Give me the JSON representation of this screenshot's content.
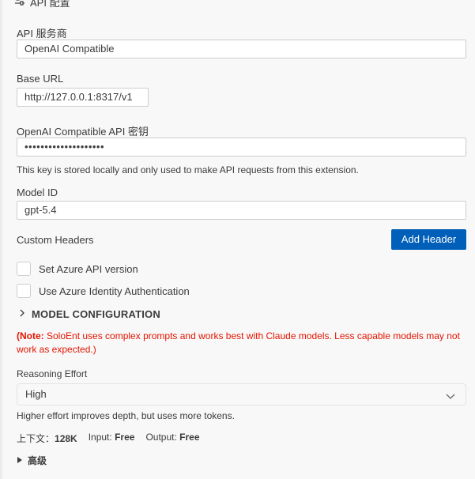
{
  "section": {
    "icon": "settings-sliders-icon",
    "title": "API 配置"
  },
  "provider": {
    "label": "API 服务商",
    "value": "OpenAI Compatible"
  },
  "base_url": {
    "label": "Base URL",
    "value": "http://127.0.0.1:8317/v1"
  },
  "api_key": {
    "label": "OpenAI Compatible API 密钥",
    "value": "••••••••••••••••••••",
    "help": "This key is stored locally and only used to make API requests from this extension."
  },
  "model_id": {
    "label": "Model ID",
    "value": "gpt-5.4"
  },
  "custom_headers": {
    "label": "Custom Headers",
    "add_button": "Add Header"
  },
  "checkboxes": [
    {
      "label": "Set Azure API version",
      "checked": false
    },
    {
      "label": "Use Azure Identity Authentication",
      "checked": false
    }
  ],
  "model_config": {
    "title": "MODEL CONFIGURATION",
    "note_prefix": "(Note:",
    "note_text": " SoloEnt uses complex prompts and works best with Claude models. Less capable models may not work as expected.)"
  },
  "reasoning": {
    "label": "Reasoning Effort",
    "value": "High",
    "help": "Higher effort improves depth, but uses more tokens."
  },
  "meta": {
    "context_label": "上下文：",
    "context_value": "128K",
    "input_label": "Input:",
    "input_value": "Free",
    "output_label": "Output:",
    "output_value": "Free"
  },
  "advanced": {
    "label": "高级"
  },
  "colors": {
    "accent": "#005fb8",
    "note": "#e51400"
  }
}
